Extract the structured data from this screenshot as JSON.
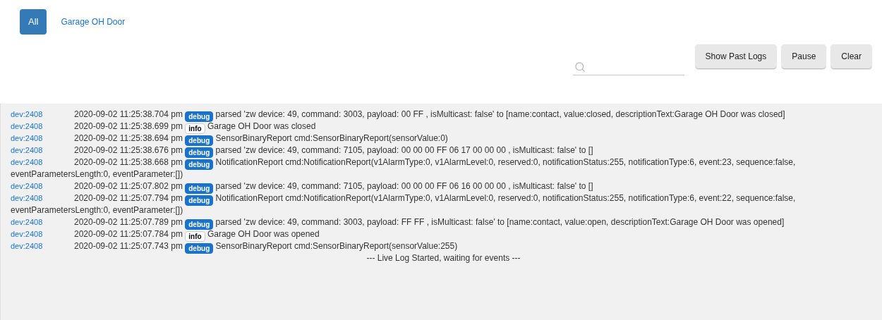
{
  "tabs": [
    {
      "label": "All",
      "selected": true
    },
    {
      "label": "Garage OH Door",
      "selected": false
    }
  ],
  "buttons": [
    "Show Past Logs",
    "Pause",
    "Clear"
  ],
  "log": [
    {
      "device": "dev:2408",
      "time": "2020-09-02 11:25:38.704 pm",
      "kind": "debug",
      "level_label": "debug",
      "message": "parsed 'zw device: 49, command: 3003, payload: 00 FF , isMulticast: false' to [name:contact, value:closed, descriptionText:Garage OH Door was closed]"
    },
    {
      "device": "dev:2408",
      "time": "2020-09-02 11:25:38.699 pm",
      "kind": "info",
      "level_label": "info",
      "message": "Garage OH Door was closed"
    },
    {
      "device": "dev:2408",
      "time": "2020-09-02 11:25:38.694 pm",
      "kind": "debug",
      "level_label": "debug",
      "message": "SensorBinaryReport cmd:SensorBinaryReport(sensorValue:0)"
    },
    {
      "device": "dev:2408",
      "time": "2020-09-02 11:25:38.676 pm",
      "kind": "debug",
      "level_label": "debug",
      "message": "parsed 'zw device: 49, command: 7105, payload: 00 00 00 FF 06 17 00 00 00 , isMulticast: false' to []"
    },
    {
      "device": "dev:2408",
      "time": "2020-09-02 11:25:38.668 pm",
      "kind": "debug",
      "level_label": "debug",
      "message": "NotificationReport cmd:NotificationReport(v1AlarmType:0, v1AlarmLevel:0, reserved:0, notificationStatus:255, notificationType:6, event:23, sequence:false,",
      "continuation": "eventParametersLength:0, eventParameter:[])"
    },
    {
      "device": "dev:2408",
      "time": "2020-09-02 11:25:07.802 pm",
      "kind": "debug",
      "level_label": "debug",
      "message": "parsed 'zw device: 49, command: 7105, payload: 00 00 00 FF 06 16 00 00 00 , isMulticast: false' to []"
    },
    {
      "device": "dev:2408",
      "time": "2020-09-02 11:25:07.794 pm",
      "kind": "debug",
      "level_label": "debug",
      "message": "NotificationReport cmd:NotificationReport(v1AlarmType:0, v1AlarmLevel:0, reserved:0, notificationStatus:255, notificationType:6, event:22, sequence:false,",
      "continuation": "eventParametersLength:0, eventParameter:[])"
    },
    {
      "device": "dev:2408",
      "time": "2020-09-02 11:25:07.789 pm",
      "kind": "debug",
      "level_label": "debug",
      "message": "parsed 'zw device: 49, command: 3003, payload: FF FF , isMulticast: false' to [name:contact, value:open, descriptionText:Garage OH Door was opened]"
    },
    {
      "device": "dev:2408",
      "time": "2020-09-02 11:25:07.784 pm",
      "kind": "info",
      "level_label": "info",
      "message": "Garage OH Door was opened"
    },
    {
      "device": "dev:2408",
      "time": "2020-09-02 11:25:07.743 pm",
      "kind": "debug",
      "level_label": "debug",
      "message": "SensorBinaryReport cmd:SensorBinaryReport(sensorValue:255)"
    }
  ],
  "status_line": "--- Live Log Started, waiting for events ---"
}
